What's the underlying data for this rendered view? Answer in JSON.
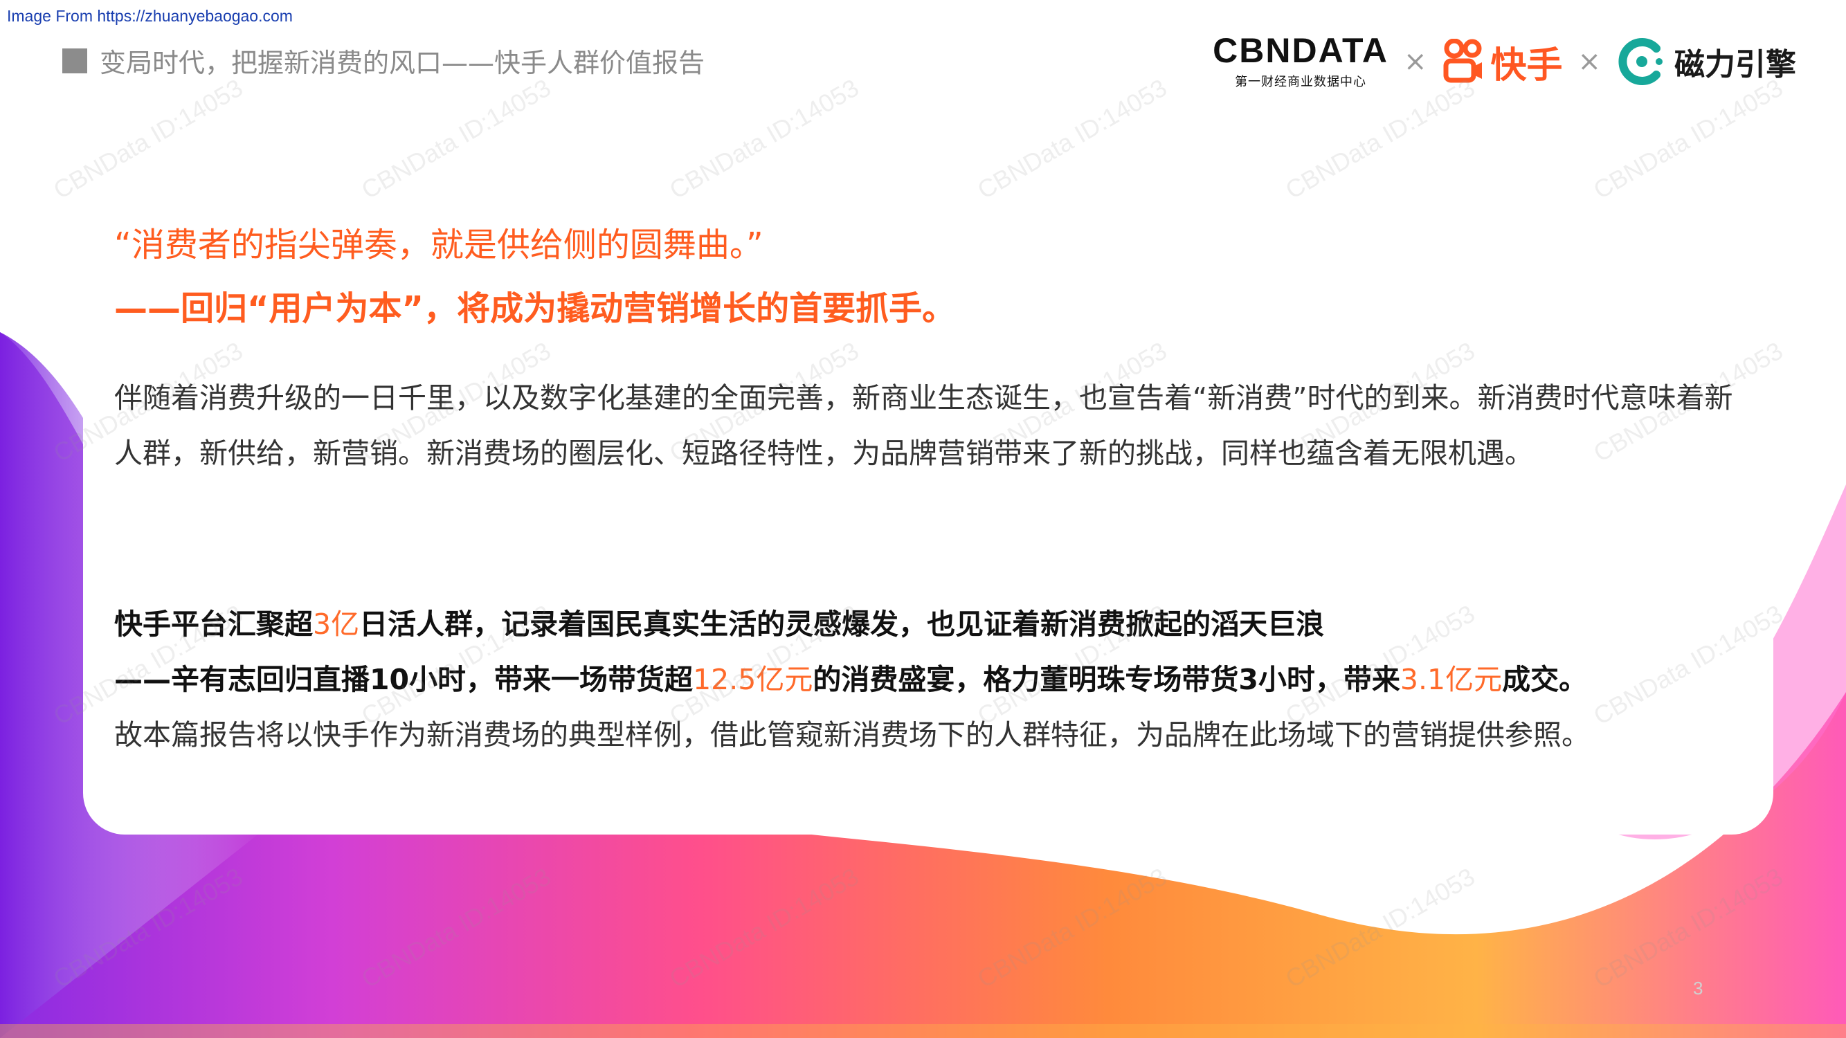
{
  "source": "Image From https://zhuanyebaogao.com",
  "header": {
    "title": "变局时代，把握新消费的风口——快手人群价值报告"
  },
  "logos": {
    "cbndata": "CBNDATA",
    "cbndata_sub": "第一财经商业数据中心",
    "times": "×",
    "kuaishou": "快手",
    "cili": "磁力引擎"
  },
  "quote": {
    "line1": "“消费者的指尖弹奏，就是供给侧的圆舞曲。”",
    "line2": "——回归“用户为本”，将成为撬动营销增长的首要抓手。"
  },
  "intro": "伴随着消费升级的一日千里，以及数字化基建的全面完善，新商业生态诞生，也宣告着“新消费”时代的到来。新消费时代意味着新人群，新供给，新营销。新消费场的圈层化、短路径特性，为品牌营销带来了新的挑战，同样也蕴含着无限机遇。",
  "highlight": {
    "l1_a": "快手平台汇聚超",
    "l1_h": "3亿",
    "l1_b": "日活人群，记录着国民真实生活的灵感爆发，也见证着新消费掀起的滔天巨浪",
    "l2_a": "——辛有志回归直播10小时，带来一场带货超",
    "l2_h1": "12.5亿元",
    "l2_b": "的消费盛宴，格力董明珠专场带货3小时，带来",
    "l2_h2": "3.1亿元",
    "l2_c": "成交。",
    "l3": "故本篇报告将以快手作为新消费场的典型样例，借此管窥新消费场下的人群特征，为品牌在此场域下的营销提供参照。"
  },
  "page_number": "3",
  "watermark": "CBNData ID:14053",
  "colors": {
    "accent": "#ff5c1f",
    "highlight": "#ff6a2a",
    "kuaishou": "#ff5722",
    "cili": "#17a89a"
  }
}
